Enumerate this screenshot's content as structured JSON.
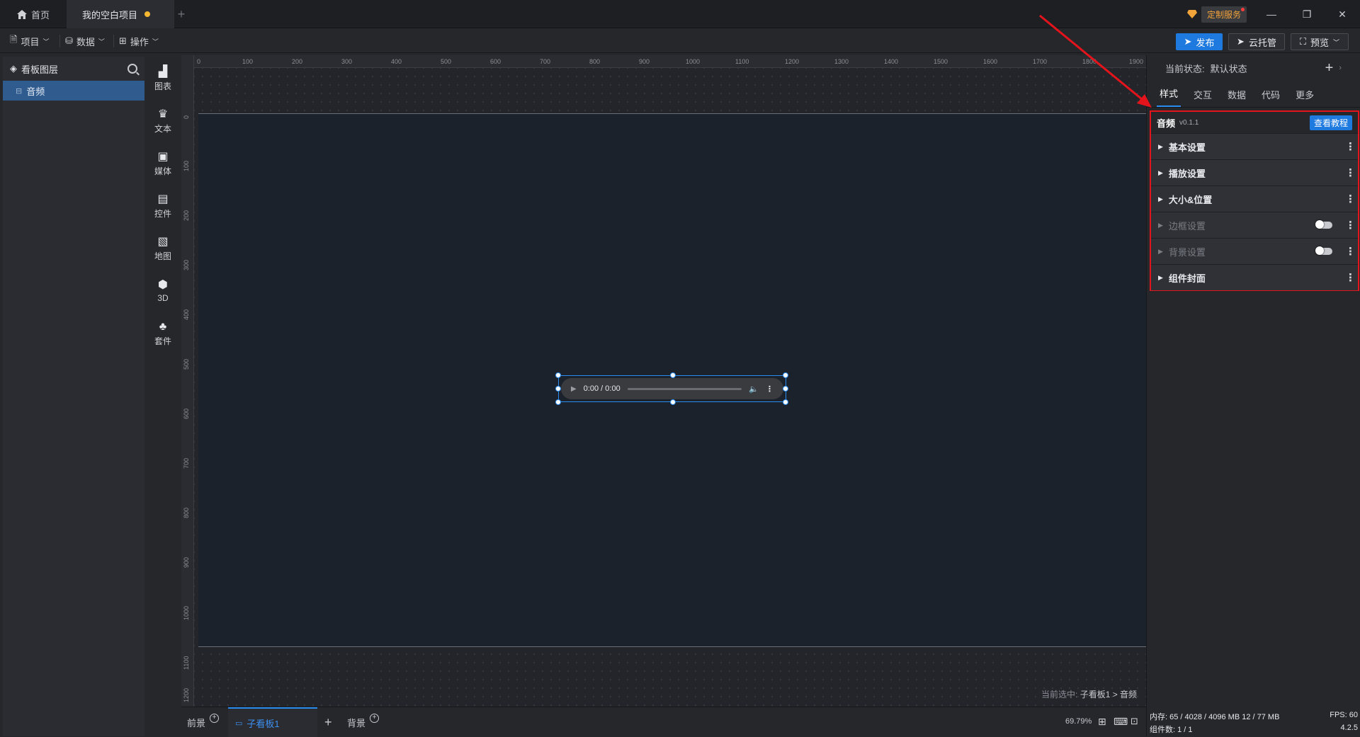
{
  "titlebar": {
    "tabs": [
      {
        "label": "首页",
        "icon": "home-icon"
      },
      {
        "label": "我的空白项目",
        "unsaved": true
      }
    ],
    "custom_service": "定制服务",
    "window_controls": [
      "minimize-icon",
      "restore-icon",
      "close-icon"
    ]
  },
  "menubar": {
    "items": [
      {
        "label": "项目",
        "icon": "document-icon"
      },
      {
        "label": "数据",
        "icon": "database-icon"
      },
      {
        "label": "操作",
        "icon": "grid-icon"
      }
    ],
    "publish_label": "发布",
    "cloud_label": "云托管",
    "preview_label": "预览"
  },
  "layers": {
    "title": "看板图层",
    "items": [
      {
        "label": "音频",
        "selected": true
      }
    ]
  },
  "toolbar": {
    "items": [
      {
        "label": "图表",
        "icon": "chart-icon"
      },
      {
        "label": "文本",
        "icon": "text-icon"
      },
      {
        "label": "媒体",
        "icon": "media-icon"
      },
      {
        "label": "控件",
        "icon": "widget-icon"
      },
      {
        "label": "地图",
        "icon": "map-icon"
      },
      {
        "label": "3D",
        "icon": "cube-icon"
      },
      {
        "label": "套件",
        "icon": "kit-icon"
      }
    ]
  },
  "ruler": {
    "top": [
      "0",
      "100",
      "200",
      "300",
      "400",
      "500",
      "600",
      "700",
      "800",
      "900",
      "1000",
      "1100",
      "1200",
      "1300",
      "1400",
      "1500",
      "1600",
      "1700",
      "1800",
      "1900"
    ],
    "left": [
      "0",
      "100",
      "200",
      "300",
      "400",
      "500",
      "600",
      "700",
      "800",
      "900",
      "1000",
      "1100",
      "1200"
    ]
  },
  "canvas": {
    "audio_time": "0:00 / 0:00",
    "selected_prefix": "当前选中:",
    "selected_path": "子看板1 > 音频"
  },
  "scenes": {
    "front": "前景",
    "sub": "子看板1",
    "add": "+",
    "background": "背景",
    "zoom": "69.79%"
  },
  "properties": {
    "state_label": "当前状态:",
    "state_value": "默认状态",
    "tabs": [
      "样式",
      "交互",
      "数据",
      "代码",
      "更多"
    ],
    "active_tab": "样式",
    "component_name": "音频",
    "component_version": "v0.1.1",
    "tutorial_label": "查看教程",
    "sections": [
      {
        "label": "基本设置",
        "enabled": true,
        "toggle": false
      },
      {
        "label": "播放设置",
        "enabled": true,
        "toggle": false
      },
      {
        "label": "大小&位置",
        "enabled": true,
        "toggle": false
      },
      {
        "label": "边框设置",
        "enabled": false,
        "toggle": true
      },
      {
        "label": "背景设置",
        "enabled": false,
        "toggle": true
      },
      {
        "label": "组件封面",
        "enabled": true,
        "toggle": false
      }
    ]
  },
  "stats": {
    "memory": "内存:  65 / 4028 / 4096 MB  12 / 77 MB",
    "fps": "FPS:  60",
    "components": "组件数: 1 / 1",
    "version": "4.2.5"
  },
  "colors": {
    "accent": "#1f7ae0",
    "highlight_box": "#e3141b",
    "unsaved_dot": "#f5b731"
  }
}
